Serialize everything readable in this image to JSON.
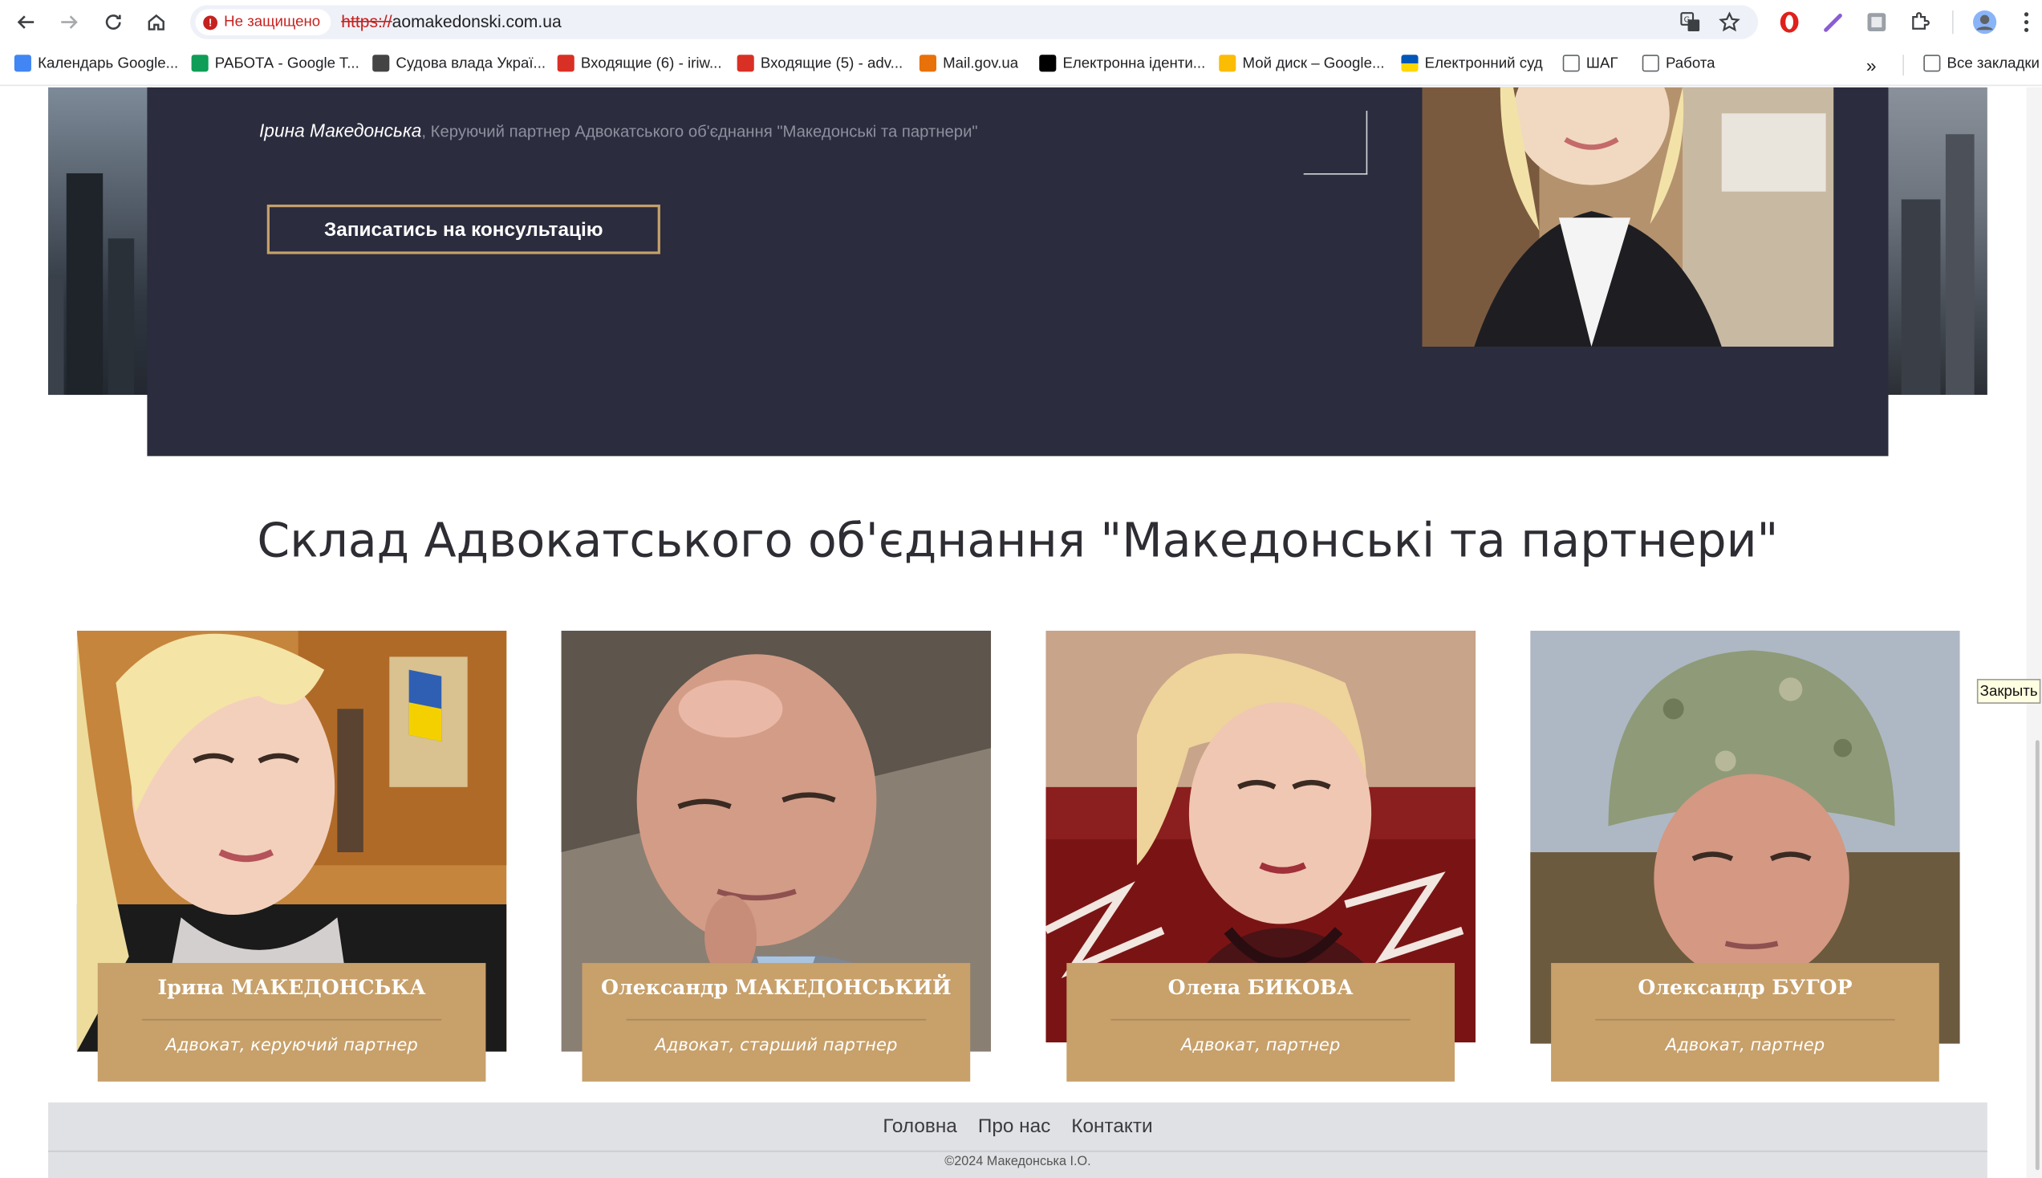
{
  "browser": {
    "security_label": "Не защищено",
    "url_scheme": "https://",
    "url_rest": "aomakedonski.com.ua"
  },
  "bookmarks": [
    {
      "label": "Календарь Google...",
      "icon": "calendar-icon",
      "color": "#4285f4"
    },
    {
      "label": "РАБОТА - Google T...",
      "icon": "sheets-icon",
      "color": "#0f9d58"
    },
    {
      "label": "Судова влада Украї...",
      "icon": "justice-icon",
      "color": "#444444"
    },
    {
      "label": "Входящие (6) - iriw...",
      "icon": "gmail-icon",
      "color": "#d93025"
    },
    {
      "label": "Входящие (5) - adv...",
      "icon": "gmail-icon",
      "color": "#d93025"
    },
    {
      "label": "Mail.gov.ua",
      "icon": "mail-gov-icon",
      "color": "#e8710a"
    },
    {
      "label": "Електронна іденти...",
      "icon": "diia-icon",
      "color": "#000000"
    },
    {
      "label": "Мой диск – Google...",
      "icon": "drive-icon",
      "color": "#fbbc04"
    },
    {
      "label": "Електронний суд",
      "icon": "ukraine-flag-icon",
      "color": "#0057b7"
    },
    {
      "label": "ШАГ",
      "icon": "folder-icon",
      "color": "#5f6368"
    },
    {
      "label": "Работа",
      "icon": "folder-icon",
      "color": "#5f6368"
    }
  ],
  "bookmarks_all": "Все закладки",
  "hero": {
    "author": "Ірина Македонська",
    "separator": ", ",
    "author_role": "Керуючий партнер Адвокатського об'єднання \"Македонські та партнери\"",
    "cta": "Записатись на консультацію"
  },
  "section_title": "Склад Адвокатського об'єднання \"Македонські та партнери\"",
  "team": [
    {
      "name": "Ірина МАКЕДОНСЬКА",
      "role": "Адвокат, керуючий партнер"
    },
    {
      "name": "Олександр МАКЕДОНСЬКИЙ",
      "role": "Адвокат, старший партнер"
    },
    {
      "name": "Олена БИКОВА",
      "role": "Адвокат, партнер"
    },
    {
      "name": "Олександр БУГОР",
      "role": "Адвокат, партнер"
    }
  ],
  "footer": {
    "links": [
      "Головна",
      "Про нас",
      "Контакти"
    ],
    "copyright": "©2024 Македонська І.О."
  },
  "tooltip": "Закрыть",
  "colors": {
    "hero_bg": "#2b2c3d",
    "accent_gold": "#c7a06a",
    "footer_bg": "#e0e1e4"
  }
}
